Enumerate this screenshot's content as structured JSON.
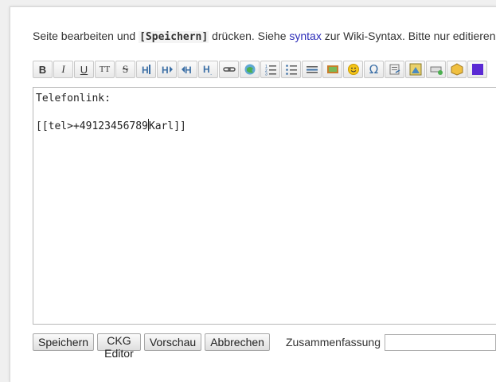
{
  "intro": {
    "before_code": "Seite bearbeiten und ",
    "code": "[Speichern]",
    "after_code": " drücken. Siehe ",
    "link": "syntax",
    "after_link": " zur Wiki-Syntax. Bitte nur editieren"
  },
  "toolbar": {
    "buttons": [
      {
        "name": "bold-button",
        "label": "B"
      },
      {
        "name": "italic-button",
        "label": "I"
      },
      {
        "name": "underline-button",
        "label": "U"
      },
      {
        "name": "monospace-button",
        "label": "TT"
      },
      {
        "name": "strike-button",
        "label": "S"
      }
    ],
    "icons": [
      "heading-same-level-icon",
      "heading-lower-level-icon",
      "heading-higher-level-icon",
      "heading-select-icon",
      "link-icon",
      "external-link-icon",
      "ordered-list-icon",
      "unordered-list-icon",
      "horizontal-rule-icon",
      "image-icon",
      "smiley-icon",
      "special-chars-icon",
      "insert-signature-icon",
      "media-icon",
      "table-icon",
      "plugin-icon",
      "color-icon"
    ]
  },
  "editor": {
    "line1": "Telefonlink:",
    "line2": "",
    "line3_before_caret": "[[tel>+49123456789",
    "line3_after_caret": "Karl]]"
  },
  "buttons": {
    "save": "Speichern",
    "ckg": "CKG Editor",
    "preview": "Vorschau",
    "cancel": "Abbrechen"
  },
  "summary": {
    "label": "Zusammenfassung",
    "value": ""
  }
}
